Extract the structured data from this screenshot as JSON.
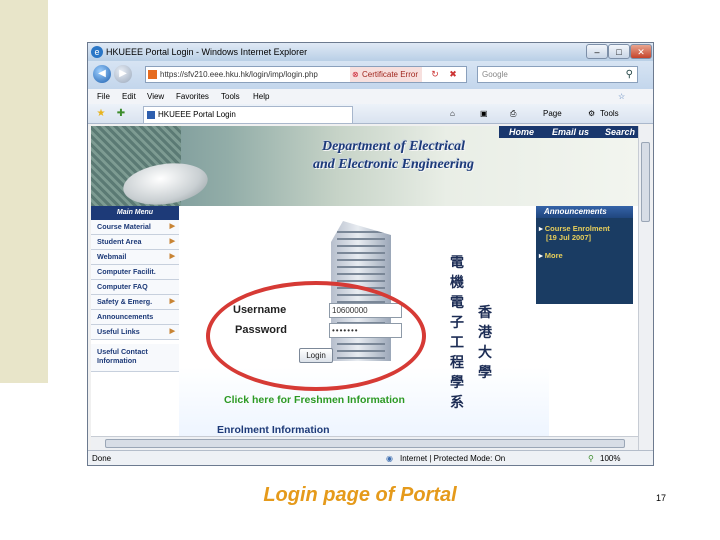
{
  "browser": {
    "window_title": "HKUEEE Portal Login - Windows Internet Explorer",
    "address": "https://sfv210.eee.hku.hk/login/imp/login.php",
    "cert_error": "Certificate Error",
    "search_placeholder": "Google",
    "menu": [
      "File",
      "Edit",
      "View",
      "Favorites",
      "Tools",
      "Help"
    ],
    "tab_title": "HKUEEE Portal Login",
    "toolbar": {
      "page": "Page",
      "tools": "Tools"
    },
    "status": {
      "done": "Done",
      "zone": "Internet | Protected Mode: On",
      "zoom": "100%"
    }
  },
  "page": {
    "top_nav": [
      "Home",
      "Email us",
      "Search"
    ],
    "dept_line1": "Department of Electrical",
    "dept_line2": "and Electronic Engineering",
    "menu_header": "Main Menu",
    "menu_items": [
      "Course Material",
      "Student Area",
      "Webmail",
      "Computer Facilit.",
      "Computer FAQ",
      "Safety & Emerg.",
      "Announcements",
      "Useful Links"
    ],
    "menu_extra": "Useful Contact Information",
    "chinese_left": [
      "電",
      "機",
      "電",
      "子",
      "工",
      "程",
      "學",
      "系"
    ],
    "chinese_right": [
      "香",
      "港",
      "大",
      "學"
    ],
    "login": {
      "username_label": "Username",
      "username_value": "10600000",
      "password_label": "Password",
      "password_value": "•••••••",
      "button": "Login"
    },
    "freshmen_link": "Click here for Freshmen Information",
    "enrolment_heading": "Enrolment Information",
    "announcements": {
      "title": "Announcements",
      "item1_line1": "Course Enrolment",
      "item1_line2": "[19 Jul 2007]",
      "more": "More"
    }
  },
  "slide": {
    "caption": "Login page of Portal",
    "page_number": "17"
  },
  "colors": {
    "accent_red": "#d63a35",
    "caption_orange": "#e59a1b",
    "navy": "#1d3a78",
    "link_green": "#2d9a24"
  }
}
